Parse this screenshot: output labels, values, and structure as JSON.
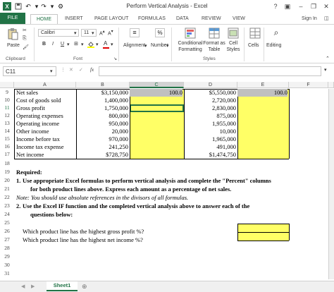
{
  "window": {
    "title": "Perform Vertical Analysis - Excel",
    "help": "?",
    "sign_in": "Sign In"
  },
  "tabs": [
    "FILE",
    "HOME",
    "INSERT",
    "PAGE LAYOUT",
    "FORMULAS",
    "DATA",
    "REVIEW",
    "VIEW"
  ],
  "ribbon": {
    "paste": "Paste",
    "clipboard": "Clipboard",
    "font_name": "Calibri",
    "font_size": "11",
    "bold": "B",
    "italic": "I",
    "underline": "U",
    "font": "Font",
    "alignment": "Alignment",
    "number": "Number",
    "conditional_formatting": "Conditional Formatting",
    "format_as_table": "Format as Table",
    "cell_styles": "Cell Styles",
    "styles": "Styles",
    "cells": "Cells",
    "editing": "Editing"
  },
  "formula_bar": {
    "name_box": "C11",
    "fx": "fx",
    "value": ""
  },
  "columns": [
    "A",
    "B",
    "C",
    "D",
    "E",
    "F"
  ],
  "rows": [
    {
      "num": "9",
      "label": "Net sales",
      "b": "$3,150,000",
      "c": "100.0",
      "d": "$5,550,000",
      "e": "100.0"
    },
    {
      "num": "10",
      "label": "Cost of goods sold",
      "b": "1,400,000",
      "c": "",
      "d": "2,720,000",
      "e": ""
    },
    {
      "num": "11",
      "label": "Gross profit",
      "b": "1,750,000",
      "c": "",
      "d": "2,830,000",
      "e": ""
    },
    {
      "num": "12",
      "label": "Operating expenses",
      "b": "800,000",
      "c": "",
      "d": "875,000",
      "e": ""
    },
    {
      "num": "13",
      "label": "Operating income",
      "b": "950,000",
      "c": "",
      "d": "1,955,000",
      "e": ""
    },
    {
      "num": "14",
      "label": "Other income",
      "b": "20,000",
      "c": "",
      "d": "10,000",
      "e": ""
    },
    {
      "num": "15",
      "label": "Income before tax",
      "b": "970,000",
      "c": "",
      "d": "1,965,000",
      "e": ""
    },
    {
      "num": "16",
      "label": "Income tax expense",
      "b": "241,250",
      "c": "",
      "d": "491,000",
      "e": ""
    },
    {
      "num": "17",
      "label": "Net income",
      "b": "$728,750",
      "c": "",
      "d": "$1,474,750",
      "e": ""
    }
  ],
  "lower_rows": [
    "18",
    "19",
    "20",
    "21",
    "22",
    "23",
    "24",
    "25",
    "26",
    "27",
    "28",
    "29",
    "30",
    "31"
  ],
  "instructions": {
    "required": "Required:",
    "q1_num": "1.",
    "q1_line1": "Use appropriate Excel formulas to perform vertical analysis and complete the \"Percent\" columns",
    "q1_line2": "for both product lines above.  Express each amount as a percentage of net sales.",
    "note": "Note: You should use absolute references in the divisors of all formulas.",
    "q2_num": "2.",
    "q2_line1": "Use the Excel IF function and the completed vertical analysis above to answer each of the",
    "q2_line2": "questions below:",
    "question_gross": "Which product line has the highest gross profit %?",
    "question_net": "Which product line has the highest net income %?"
  },
  "sheet_tab": "Sheet1",
  "colors": {
    "excel_green": "#217346",
    "yellow": "#ffff66",
    "selected_header": "#d3d3d3"
  }
}
